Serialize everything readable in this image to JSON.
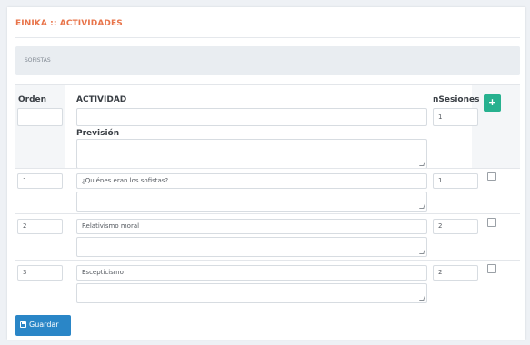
{
  "app": {
    "title": "EINIKA :: ACTIVIDADES"
  },
  "breadcrumb": {
    "text": "SOFISTAS"
  },
  "table": {
    "headers": {
      "orden": "Orden",
      "actividad": "ACTIVIDAD",
      "nsesiones": "nSesiones",
      "prevision": "Previsión"
    },
    "new_row": {
      "orden": "",
      "actividad": "",
      "nsesiones": "1",
      "prevision": ""
    },
    "add_label": "+",
    "rows": [
      {
        "orden": "1",
        "actividad": "¿Quiénes eran los sofistas?",
        "nsesiones": "1",
        "prevision": ""
      },
      {
        "orden": "2",
        "actividad": "Relativismo moral",
        "nsesiones": "2",
        "prevision": ""
      },
      {
        "orden": "3",
        "actividad": "Escepticismo",
        "nsesiones": "2",
        "prevision": ""
      }
    ]
  },
  "save_button": {
    "label": "Guardar",
    "icon": "save-icon"
  },
  "colors": {
    "accent": "#e8744a",
    "add": "#27b18f",
    "primary": "#2a86c7"
  }
}
